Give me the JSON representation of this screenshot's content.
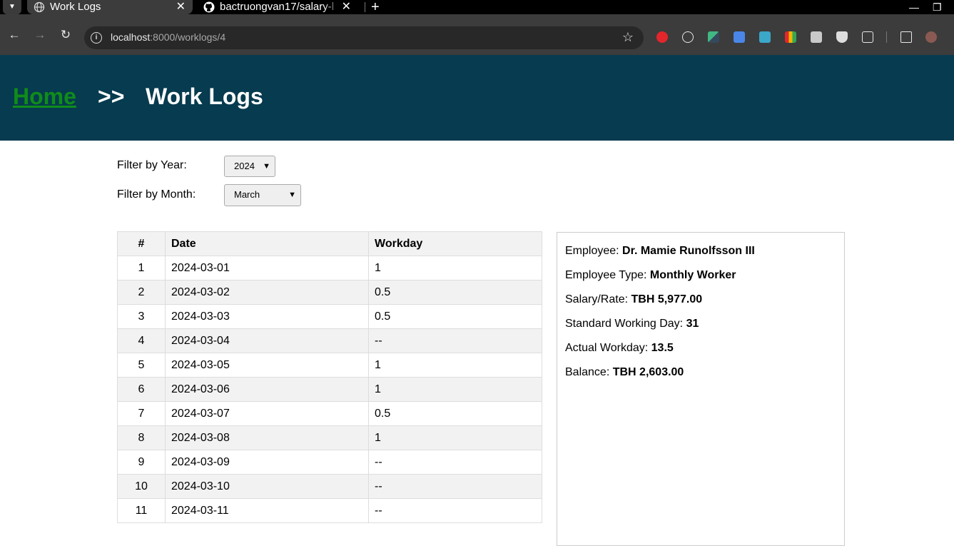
{
  "browser": {
    "tabs": [
      {
        "title": "Work Logs",
        "active": true
      },
      {
        "title": "bactruongvan17/salary-l",
        "active": false
      }
    ],
    "url_host": "localhost",
    "url_path": ":8000/worklogs/4",
    "icons": {
      "tab_list": "chevron-down-icon",
      "new_tab": "plus-icon",
      "back": "arrow-left-icon",
      "forward": "arrow-right-icon",
      "reload": "reload-icon",
      "site_info": "info-icon",
      "bookmark": "star-icon",
      "minimize": "minimize-icon",
      "restore": "restore-icon"
    },
    "extension_colors": [
      "#e3262b",
      "#e8e8e8",
      "#41b883",
      "#4a86e8",
      "#3ba7c9",
      "#f4b400",
      "#c9c9c9",
      "#dddddd",
      "#e8e8e8"
    ]
  },
  "header": {
    "home_link": "Home",
    "separator": ">>",
    "title": "Work Logs",
    "colors": {
      "background": "#073b4f",
      "home_link": "#0f8c1a",
      "text": "#ffffff"
    }
  },
  "filters": {
    "year_label": "Filter by Year:",
    "year_value": "2024",
    "month_label": "Filter by Month:",
    "month_value": "March"
  },
  "table": {
    "headers": [
      "#",
      "Date",
      "Workday"
    ],
    "rows": [
      [
        "1",
        "2024-03-01",
        "1"
      ],
      [
        "2",
        "2024-03-02",
        "0.5"
      ],
      [
        "3",
        "2024-03-03",
        "0.5"
      ],
      [
        "4",
        "2024-03-04",
        "--"
      ],
      [
        "5",
        "2024-03-05",
        "1"
      ],
      [
        "6",
        "2024-03-06",
        "1"
      ],
      [
        "7",
        "2024-03-07",
        "0.5"
      ],
      [
        "8",
        "2024-03-08",
        "1"
      ],
      [
        "9",
        "2024-03-09",
        "--"
      ],
      [
        "10",
        "2024-03-10",
        "--"
      ],
      [
        "11",
        "2024-03-11",
        "--"
      ]
    ]
  },
  "summary": {
    "employee_label": "Employee:",
    "employee_value": "Dr. Mamie Runolfsson III",
    "type_label": "Employee Type:",
    "type_value": "Monthly Worker",
    "salary_label": "Salary/Rate:",
    "salary_value": "TBH 5,977.00",
    "standard_label": "Standard Working Day:",
    "standard_value": "31",
    "actual_label": "Actual Workday:",
    "actual_value": "13.5",
    "balance_label": "Balance:",
    "balance_value": "TBH 2,603.00"
  }
}
